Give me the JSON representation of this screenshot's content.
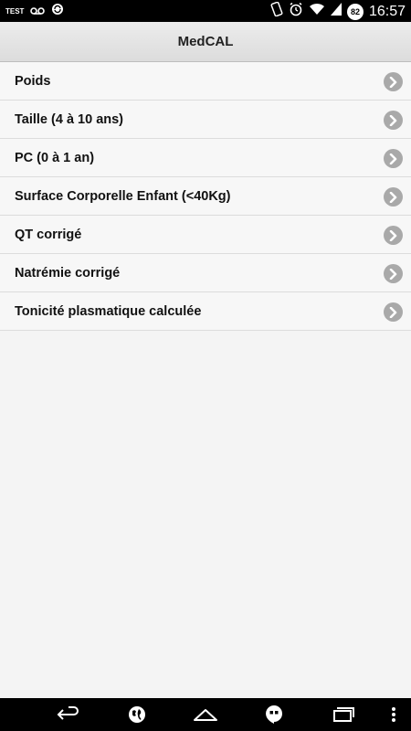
{
  "status_bar": {
    "carrier_label": "TEST",
    "battery_level": "82",
    "time": "16:57",
    "icons": [
      "test-icon",
      "voicemail-icon",
      "sync-icon",
      "vibrate-icon",
      "alarm-icon",
      "wifi-icon",
      "signal-icon",
      "battery-icon"
    ]
  },
  "app_bar": {
    "title": "MedCAL"
  },
  "menu": {
    "items": [
      {
        "label": "Poids",
        "icon": "chevron-right-icon"
      },
      {
        "label": "Taille (4 à 10 ans)",
        "icon": "chevron-right-icon"
      },
      {
        "label": "PC (0 à 1 an)",
        "icon": "chevron-right-icon"
      },
      {
        "label": "Surface Corporelle Enfant (<40Kg)",
        "icon": "chevron-right-icon"
      },
      {
        "label": "QT corrigé",
        "icon": "chevron-right-icon"
      },
      {
        "label": "Natrémie corrigé",
        "icon": "chevron-right-icon"
      },
      {
        "label": "Tonicité plasmatique calculée",
        "icon": "chevron-right-icon"
      }
    ]
  },
  "nav_bar": {
    "buttons": [
      "back-icon",
      "globe-icon",
      "home-icon",
      "hangouts-icon",
      "recent-apps-icon",
      "overflow-menu-icon"
    ]
  },
  "colors": {
    "status_bar_bg": "#000000",
    "app_bar_bg": "#e4e4e4",
    "list_bg": "#f7f7f7",
    "chevron_bg": "#a9a9a9",
    "nav_bar_bg": "#000000"
  }
}
